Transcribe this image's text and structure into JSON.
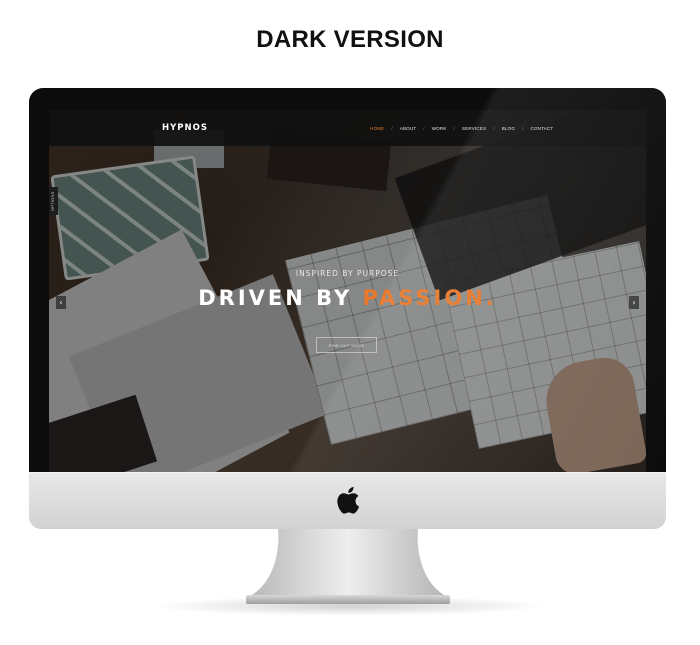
{
  "heading": "DARK VERSION",
  "site": {
    "brand": "HYPNOS",
    "nav": [
      {
        "label": "HOME",
        "active": true
      },
      {
        "label": "ABOUT",
        "active": false
      },
      {
        "label": "WORK",
        "active": false
      },
      {
        "label": "SERVICES",
        "active": false
      },
      {
        "label": "BLOG",
        "active": false
      },
      {
        "label": "CONTACT",
        "active": false
      }
    ],
    "nav_separator": "/",
    "options_tab": "OPTIONS",
    "hero": {
      "subtitle": "INSPIRED BY PURPOSE",
      "title_main": "DRIVEN BY ",
      "title_accent": "PASSION.",
      "cta": "FIND OUT MORE"
    },
    "slider": {
      "prev_icon": "‹",
      "next_icon": "›"
    }
  },
  "colors": {
    "accent": "#e8782b",
    "navbar": "#101010",
    "bezel": "#0c0c0c",
    "chin": "#dcdcdc"
  },
  "icons": [
    "chevron-left-icon",
    "chevron-right-icon",
    "apple-logo-icon"
  ]
}
